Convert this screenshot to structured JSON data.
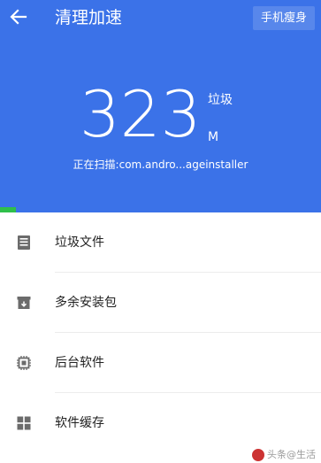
{
  "header": {
    "title": "清理加速",
    "action_label": "手机瘦身",
    "back_icon": "arrow-left-icon",
    "background_color": "#3b72e8"
  },
  "scan": {
    "size_value": "323",
    "type_label": "垃圾",
    "size_unit": "M",
    "status_text": "正在扫描:com.andro...ageinstaller",
    "progress_fraction": 0.05,
    "progress_color": "#2fbf4a"
  },
  "list": {
    "items": [
      {
        "label": "垃圾文件",
        "icon": "document-list-icon"
      },
      {
        "label": "多余安装包",
        "icon": "package-box-icon"
      },
      {
        "label": "后台软件",
        "icon": "cpu-chip-icon"
      },
      {
        "label": "软件缓存",
        "icon": "grid-apps-icon"
      }
    ]
  },
  "watermark": {
    "text": "头条@生活"
  }
}
